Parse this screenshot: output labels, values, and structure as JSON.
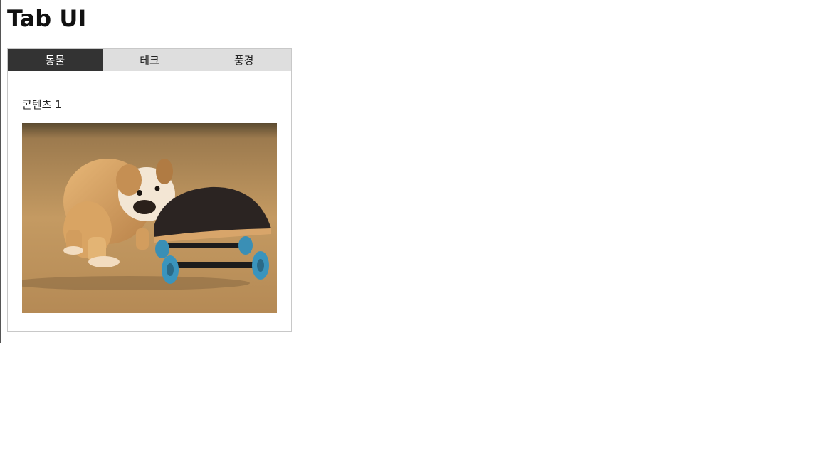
{
  "page": {
    "title": "Tab UI"
  },
  "tabs": [
    {
      "label": "동물",
      "active": true
    },
    {
      "label": "테크",
      "active": false
    },
    {
      "label": "풍경",
      "active": false
    }
  ],
  "panel": {
    "content_title": "콘텐츠 1",
    "image_icon": "bulldog-puppy-on-skateboard-photo"
  },
  "colors": {
    "active_tab_bg": "#333333",
    "inactive_tab_bg": "#dedede",
    "border": "#c8c8c8"
  }
}
